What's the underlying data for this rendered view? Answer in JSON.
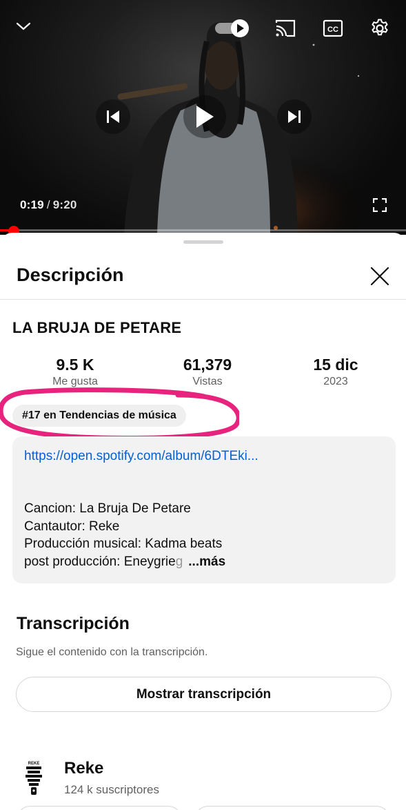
{
  "player": {
    "current_time": "0:19",
    "separator": "/",
    "total_time": "9:20",
    "progress": 0.034,
    "autoplay_on": true
  },
  "sheet": {
    "title": "Descripción"
  },
  "video": {
    "title": "LA BRUJA DE PETARE",
    "stats": [
      {
        "value": "9.5 K",
        "label": "Me gusta"
      },
      {
        "value": "61,379",
        "label": "Vistas"
      },
      {
        "value": "15 dic",
        "label": "2023"
      }
    ],
    "trending_chip": "#17 en Tendencias de música"
  },
  "description": {
    "link": "https://open.spotify.com/album/6DTEki...",
    "lines": [
      "Cancion: La Bruja De Petare",
      "Cantautor: Reke",
      "Producción musical: Kadma beats"
    ],
    "last_line_start": "post producción: Eneygrie",
    "last_line_faded": "g",
    "more_label": "...más"
  },
  "transcript": {
    "title": "Transcripción",
    "subtitle": "Sigue el contenido con la transcripción.",
    "button_label": "Mostrar transcripción"
  },
  "channel": {
    "name": "Reke",
    "subscribers": "124 k suscriptores"
  },
  "colors": {
    "progress": "#ff0000",
    "link": "#065fd4",
    "highlight": "#e8237e"
  },
  "icons": [
    "chevron-down-icon",
    "autoplay-toggle",
    "cast-icon",
    "captions-icon",
    "settings-icon",
    "previous-icon",
    "play-icon",
    "next-icon",
    "fullscreen-icon",
    "close-icon"
  ]
}
